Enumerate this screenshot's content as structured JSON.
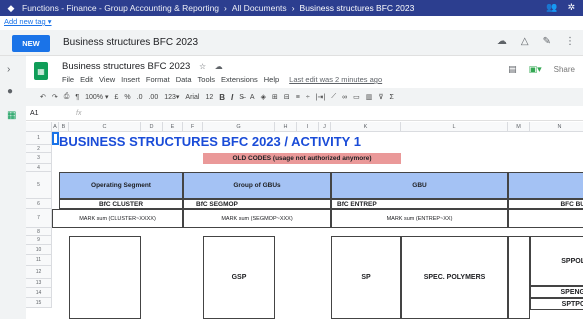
{
  "breadcrumb": {
    "parent": "Functions - Finance - Group Accounting & Reporting",
    "docs": "All Documents",
    "current": "Business structures BFC 2023"
  },
  "add_tag": "Add new tag ▾",
  "new_button": "NEW",
  "doc_title": "Business structures BFC 2023",
  "sheet": {
    "name": "Business structures BFC 2023",
    "menus": [
      "File",
      "Edit",
      "View",
      "Insert",
      "Format",
      "Data",
      "Tools",
      "Extensions",
      "Help"
    ],
    "last_edit": "Last edit was 2 minutes ago",
    "share": "Share"
  },
  "toolbar": {
    "zoom": "100% ▾",
    "currency": "£",
    "percent": "%",
    "dec_less": ".0",
    "dec_more": ".00",
    "format": "123▾",
    "font": "Arial",
    "size": "12"
  },
  "formula": {
    "ref": "A1",
    "fx": "fx"
  },
  "columns": [
    "A",
    "B",
    "C",
    "D",
    "E",
    "F",
    "G",
    "H",
    "I",
    "J",
    "K",
    "L",
    "M",
    "N"
  ],
  "rows": [
    "1",
    "2",
    "3",
    "4",
    "5",
    "6",
    "7",
    "8",
    "9",
    "10",
    "11",
    "12",
    "13",
    "14",
    "15"
  ],
  "content": {
    "title": "BUSINESS STRUCTURES BFC 2023 / ACTIVITY 1",
    "old_codes": "OLD CODES (usage not authorized anymore)",
    "h_operating": "Operating Segment",
    "h_group_gbu": "Group of GBUs",
    "h_gbu": "GBU",
    "bfc_cluster": "BfC CLUSTER",
    "bfc_segmop": "BfC SEGMOP",
    "bfc_entrep": "BfC ENTREP",
    "bfc_bu": "BFC BU",
    "mark_cluster": "MARK sum (CLUSTER~XXXX)",
    "mark_segmop": "MARK sum (SEGMOP~XXX)",
    "mark_entrep": "MARK sum (ENTREP~XX)",
    "gsp": "GSP",
    "sp": "SP",
    "spec_polymers": "SPEC. POLYMERS",
    "sppol": "SPPOL",
    "speng": "SPENG",
    "sptpc": "SPTPC"
  }
}
